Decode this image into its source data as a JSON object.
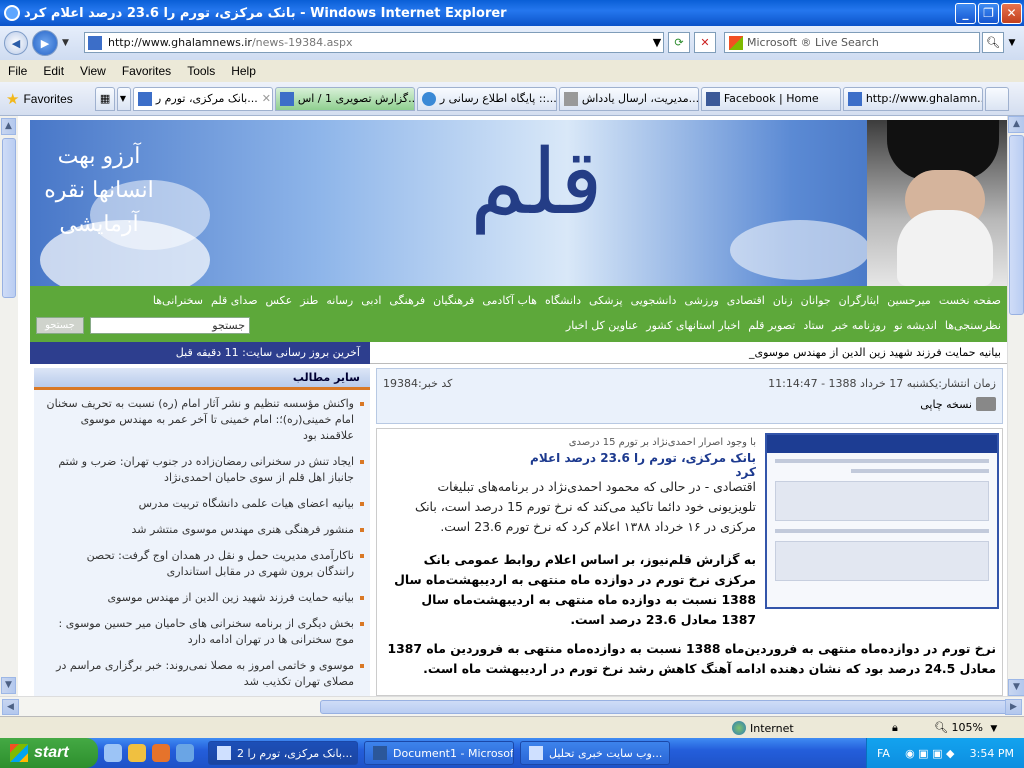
{
  "window": {
    "title": "بانک مرکزی، تورم را 23.6 درصد اعلام کرد - Windows Internet Explorer"
  },
  "address": {
    "url_domain": "http://www.ghalamnews.ir",
    "url_path": "/news-19384.aspx",
    "search_placeholder": "Microsoft ® Live Search"
  },
  "menu": [
    "File",
    "Edit",
    "View",
    "Favorites",
    "Tools",
    "Help"
  ],
  "favorites_label": "Favorites",
  "tabs": [
    {
      "label": "بانک مرکزی، تورم ر...",
      "active": true
    },
    {
      "label": "گزارش تصویری 1 / اس...",
      "active": false
    },
    {
      "label": "پایگاه اطلاع رسانی ر ::...",
      "active": false
    },
    {
      "label": "مدیریت، ارسال یادداش...",
      "active": false
    },
    {
      "label": "Facebook | Home",
      "active": false
    },
    {
      "label": "http://www.ghalamn...",
      "active": false
    }
  ],
  "header": {
    "logo": "قلم",
    "slogan": "آرزو بهت انسانها نقره آزمایشی"
  },
  "nav": {
    "row1": [
      "صفحه نخست",
      "میرحسین",
      "ایثارگران",
      "جوانان",
      "زنان",
      "اقتصادی",
      "ورزشی",
      "دانشجویی",
      "پزشکی",
      "دانشگاه",
      "هاب آکادمی",
      "فرهنگیان",
      "فرهنگی",
      "ادبی",
      "رسانه",
      "طنز",
      "عکس",
      "صدای قلم",
      "سخنرانی‌ها"
    ],
    "row2": [
      "نظرسنجی‌ها",
      "اندیشه نو",
      "روزنامه خبر",
      "ستاد",
      "تصویر قلم",
      "اخبار استانهای کشور",
      "عناوین کل اخبار"
    ],
    "search_placeholder": "جستجو",
    "search_button": "جستجو"
  },
  "ticker": {
    "news": "بیانیه حمایت فرزند شهید زین الدین از مهندس موسوی_",
    "updated": "آخرین بروز رسانی سایت: 11 دقیقه قبل"
  },
  "sidebar": {
    "title": "سایر مطالب",
    "items": [
      "واکنش مؤسسه تنظیم و نشر آثار امام (ره) نسبت به تحریف سخنان امام خمینی(ره)؛: امام خمینی تا آخر عمر به مهندس موسوی علاقمند بود",
      "ایجاد تنش در سخنرانی رمضان‌زاده در جنوب تهران: ضرب و شتم جانباز اهل قلم از سوی حامیان احمدی‌نژاد",
      "بیانیه اعضای هیات علمی دانشگاه تربیت مدرس",
      "منشور فرهنگی هنری مهندس موسوی منتشر شد",
      "ناکارآمدی مدیریت حمل و نقل در همدان اوج گرفت: تحصن رانندگان برون شهری در مقابل استانداری",
      "بیانیه حمایت فرزند شهید زین الدین از مهندس موسوی",
      "بخش دیگری از برنامه سخنرانی های حامیان میر حسین موسوی : موج سخنرانی ها در تهران ادامه دارد",
      "موسوی و خاتمی امروز به مصلا نمی‌روند: خبر برگزاری مراسم در مصلای تهران تکذیب شد"
    ]
  },
  "article": {
    "date": "زمان انتشار:یکشنبه 17 خرداد 1388 - 11:14:47",
    "code": "کد خبر:19384",
    "print": "نسخه چاپی",
    "kicker": "با وجود اصرار احمدی‌نژاد بر تورم 15 درصدی",
    "title": "بانک مرکزی، تورم را 23.6 درصد اعلام کرد",
    "lead": "اقتصادی - در حالی که محمود احمدی‌نژاد در برنامه‌های تبلیغات تلویزیونی خود دائما تاکید می‌کند که نرخ تورم 15 درصد است، بانک مرکزی در ۱۶ خرداد ۱۳۸۸ اعلام کرد که نرخ تورم 23.6 است.",
    "p1": "به گزارش قلم‌نیوز، بر اساس اعلام روابط عمومی بانک مرکزی نرخ تورم در دوازده ماه منتهی به اردیبهشت‌ماه سال 1388 نسبت به دوازده ماه منتهی به اردیبهشت‌ماه سال 1387 معادل 23.6 درصد است.",
    "p2": "نرخ تورم در دوازده‌ماه منتهی به فروردین‌ماه 1388 نسبت به دوازده‌ماه منتهی به فروردین ماه 1387 معادل 24.5 درصد بود که نشان دهنده ادامه آهنگ کاهش رشد نرخ تورم در اردیبهشت ماه است."
  },
  "status": {
    "zone": "Internet",
    "zoom": "105%"
  },
  "taskbar": {
    "start": "start",
    "tasks": [
      {
        "label": "2 بانک مرکزی، تورم را...",
        "active": true
      },
      {
        "label": "Document1 - Microsof...",
        "active": false
      },
      {
        "label": "وب سایت خبری تحلیل...",
        "active": false
      }
    ],
    "lang": "FA",
    "clock": "3:54 PM"
  }
}
